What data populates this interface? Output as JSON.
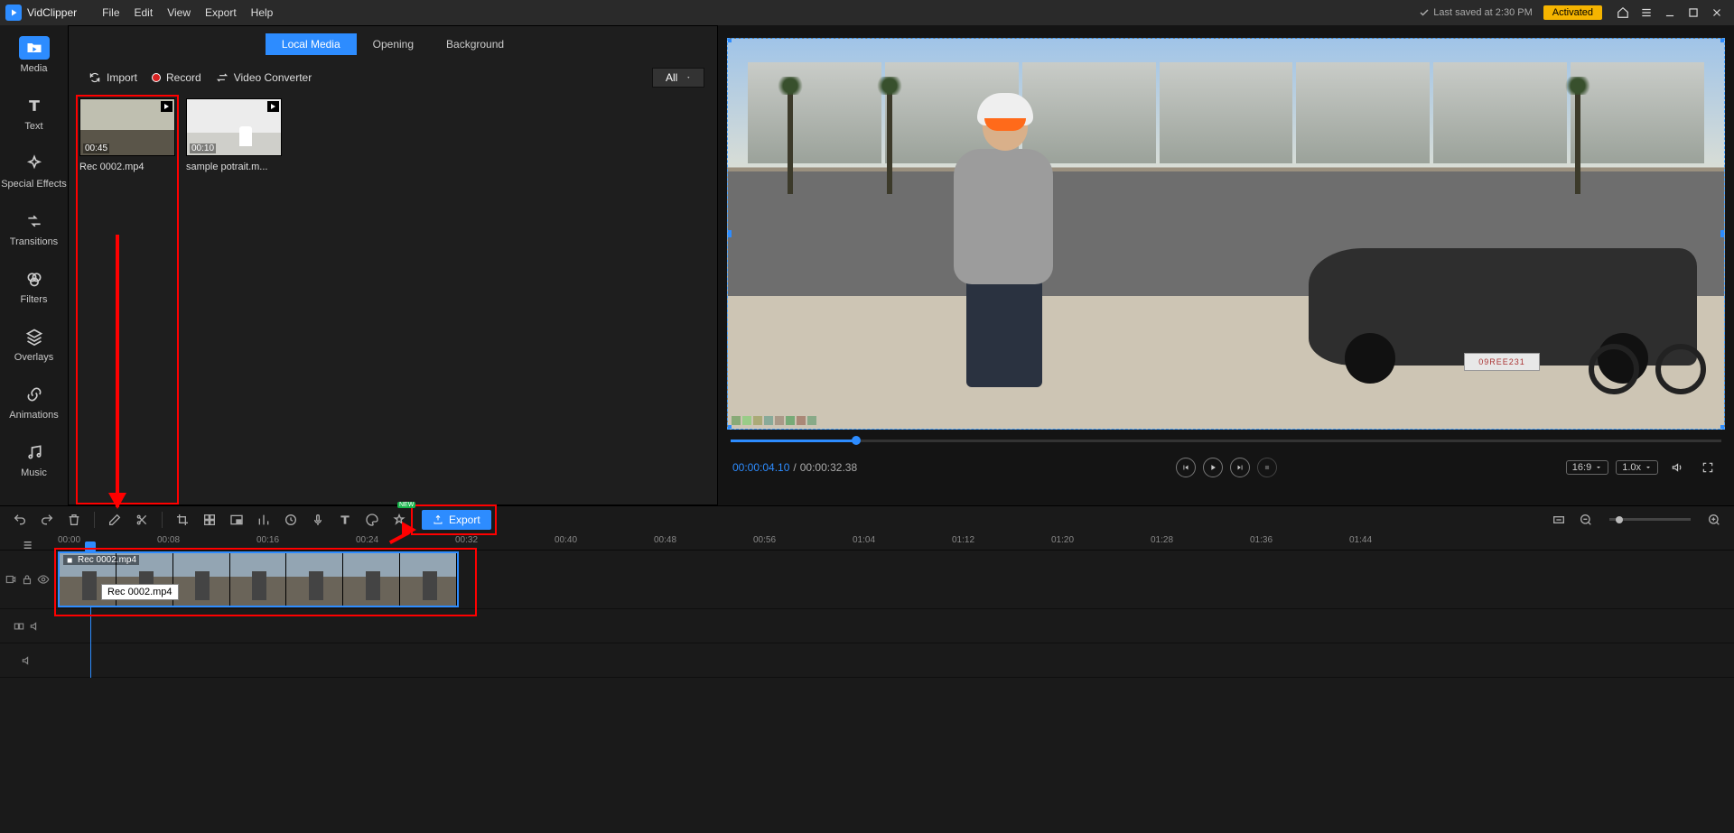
{
  "app": {
    "name": "VidClipper"
  },
  "menu": {
    "file": "File",
    "edit": "Edit",
    "view": "View",
    "export": "Export",
    "help": "Help"
  },
  "status": {
    "saved": "Last saved at 2:30 PM",
    "activated": "Activated"
  },
  "sidebar": {
    "items": [
      {
        "label": "Media"
      },
      {
        "label": "Text"
      },
      {
        "label": "Special Effects"
      },
      {
        "label": "Transitions"
      },
      {
        "label": "Filters"
      },
      {
        "label": "Overlays"
      },
      {
        "label": "Animations"
      },
      {
        "label": "Music"
      }
    ]
  },
  "media_tabs": {
    "local": "Local Media",
    "opening": "Opening",
    "background": "Background"
  },
  "actions": {
    "import": "Import",
    "record": "Record",
    "converter": "Video Converter"
  },
  "filter": {
    "label": "All"
  },
  "clips": [
    {
      "duration": "00:45",
      "name": "Rec 0002.mp4"
    },
    {
      "duration": "00:10",
      "name": "sample potrait.m..."
    }
  ],
  "preview": {
    "plate": "09REE231",
    "time_current": "00:00:04.10",
    "time_total": "00:00:32.38",
    "aspect": "16:9",
    "speed": "1.0x"
  },
  "toolbar": {
    "export": "Export",
    "new_tag": "NEW"
  },
  "ruler": [
    "00:00",
    "00:08",
    "00:16",
    "00:24",
    "00:32",
    "00:40",
    "00:48",
    "00:56",
    "01:04",
    "01:12",
    "01:20",
    "01:28",
    "01:36",
    "01:44"
  ],
  "timeline": {
    "clip_label": "Rec 0002.mp4",
    "tooltip": "Rec 0002.mp4"
  }
}
